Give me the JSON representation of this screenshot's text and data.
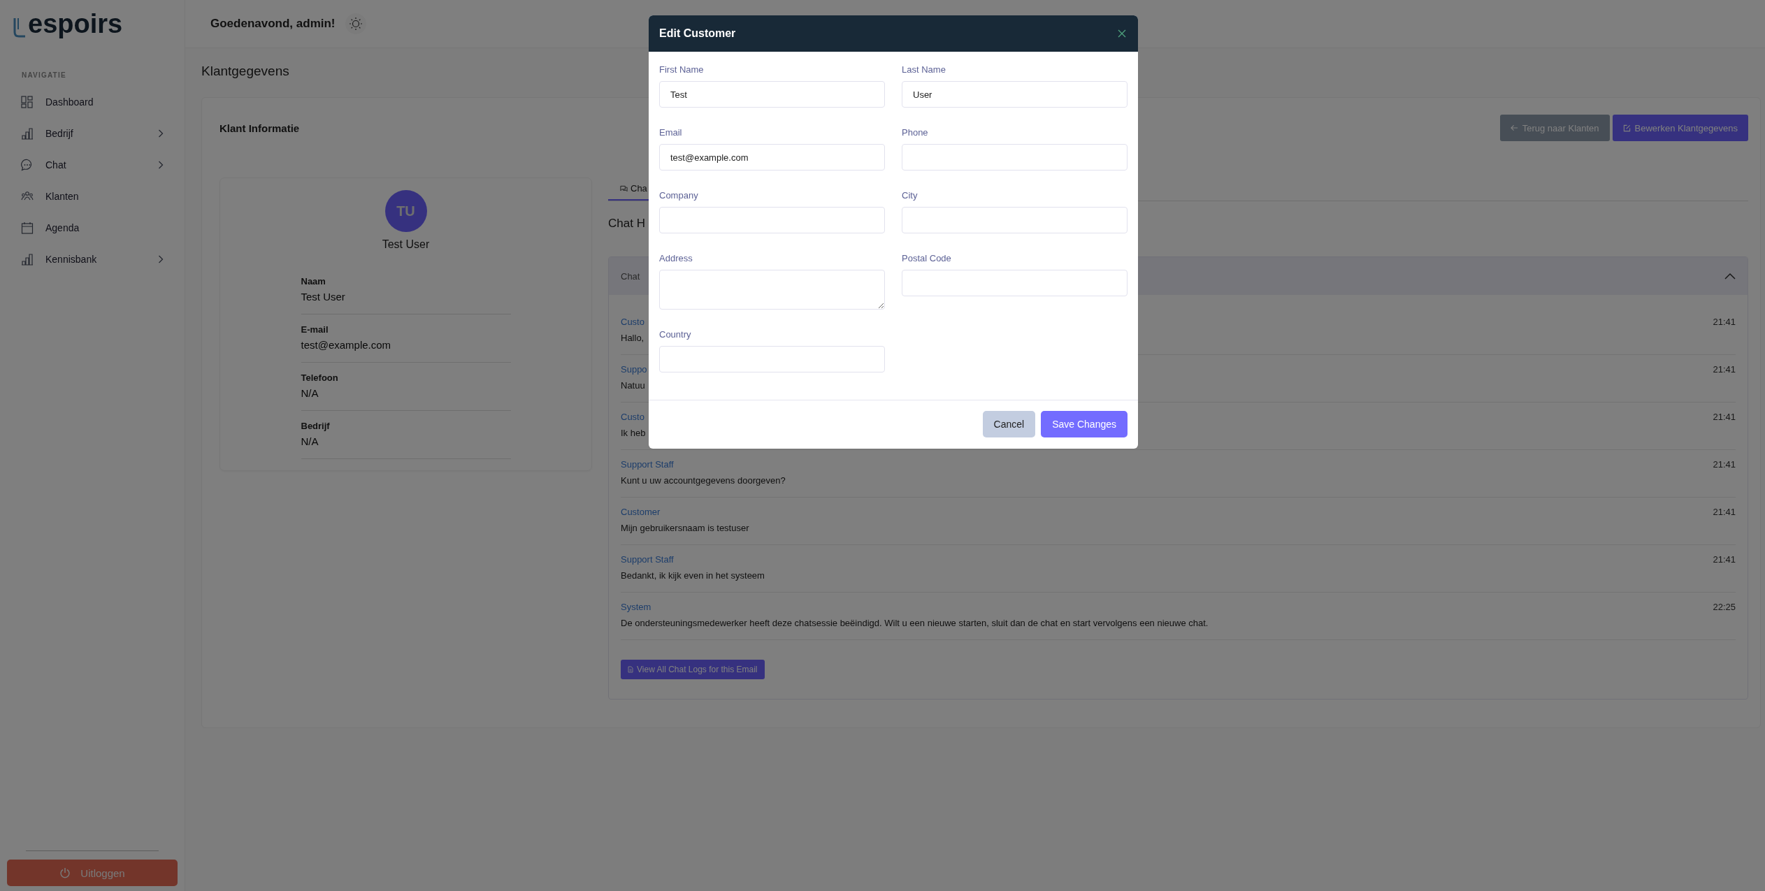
{
  "sidebar": {
    "logo": "espoirs",
    "section_title": "NAVIGATIE",
    "items": [
      {
        "label": "Dashboard",
        "expandable": false
      },
      {
        "label": "Bedrijf",
        "expandable": true
      },
      {
        "label": "Chat",
        "expandable": true
      },
      {
        "label": "Klanten",
        "expandable": false
      },
      {
        "label": "Agenda",
        "expandable": false
      },
      {
        "label": "Kennisbank",
        "expandable": true
      }
    ],
    "logout": "Uitloggen"
  },
  "header": {
    "greeting": "Goedenavond, admin!"
  },
  "page_title": "Klantgegevens",
  "card": {
    "title": "Klant Informatie",
    "buttons": [
      {
        "label": "Terug naar Klanten",
        "kind": "back"
      },
      {
        "label": "Bewerken Klantgegevens",
        "kind": "edit"
      }
    ]
  },
  "profile": {
    "initials": "TU",
    "name": "Test User",
    "fields": [
      {
        "label": "Naam",
        "value": "Test User"
      },
      {
        "label": "E-mail",
        "value": "test@example.com"
      },
      {
        "label": "Telefoon",
        "value": "N/A"
      },
      {
        "label": "Bedrijf",
        "value": "N/A"
      }
    ]
  },
  "chat": {
    "tab": "Cha",
    "heading": "Chat H",
    "panel_title": "Chat",
    "expanded": true,
    "messages": [
      {
        "sender": "Custo",
        "text": "Hallo,",
        "time": "21:41"
      },
      {
        "sender": "Suppo",
        "text": "Natuu",
        "time": "21:41"
      },
      {
        "sender": "Custo",
        "text": "Ik heb",
        "time": "21:41"
      },
      {
        "sender": "Support Staff",
        "text": "Kunt u uw accountgegevens doorgeven?",
        "time": "21:41"
      },
      {
        "sender": "Customer",
        "text": "Mijn gebruikersnaam is testuser",
        "time": "21:41"
      },
      {
        "sender": "Support Staff",
        "text": "Bedankt, ik kijk even in het systeem",
        "time": "21:41"
      },
      {
        "sender": "System",
        "text": "De ondersteuningsmedewerker heeft deze chatsessie beëindigd. Wilt u een nieuwe starten, sluit dan de chat en start vervolgens een nieuwe chat.",
        "time": "22:25"
      }
    ],
    "button": "View All Chat Logs for this Email"
  },
  "modal": {
    "title": "Edit Customer",
    "fields": [
      {
        "label": "First Name",
        "value": "Test",
        "kind": "input"
      },
      {
        "label": "Last Name",
        "value": "User",
        "kind": "input"
      },
      {
        "label": "Email",
        "value": "test@example.com",
        "kind": "input"
      },
      {
        "label": "Phone",
        "kind": "input"
      },
      {
        "label": "Company",
        "kind": "input"
      },
      {
        "label": "City",
        "kind": "input"
      },
      {
        "label": "Address",
        "kind": "textarea"
      },
      {
        "label": "Postal Code",
        "kind": "input"
      },
      {
        "label": "Country",
        "kind": "input"
      }
    ],
    "buttons": [
      {
        "label": "Cancel",
        "kind": "secondary"
      },
      {
        "label": "Save Changes",
        "kind": "primary"
      }
    ]
  }
}
